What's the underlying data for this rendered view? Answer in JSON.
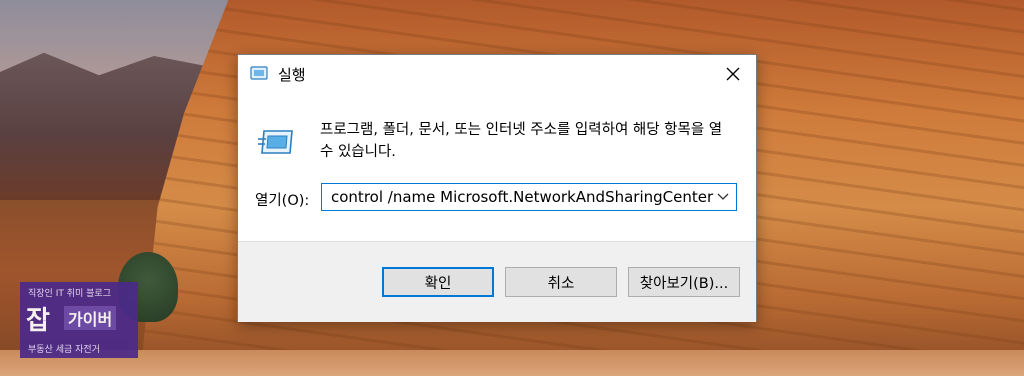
{
  "dialog": {
    "title": "실행",
    "icon": "run-icon",
    "description": "프로그램, 폴더, 문서, 또는 인터넷 주소를 입력하여 해당 항목을 열 수 있습니다.",
    "open_label": "열기(O):",
    "open_value": "control /name Microsoft.NetworkAndSharingCenter",
    "buttons": {
      "ok": "확인",
      "cancel": "취소",
      "browse": "찾아보기(B)..."
    }
  },
  "watermark": {
    "top": "직장인 IT 취미 블로그",
    "big": "잡",
    "mid": "가이버",
    "bottom": "부동산 세금 자전거"
  },
  "colors": {
    "accent": "#0078d7",
    "footer": "#f0f0f0",
    "logo": "#4b2a8a"
  }
}
